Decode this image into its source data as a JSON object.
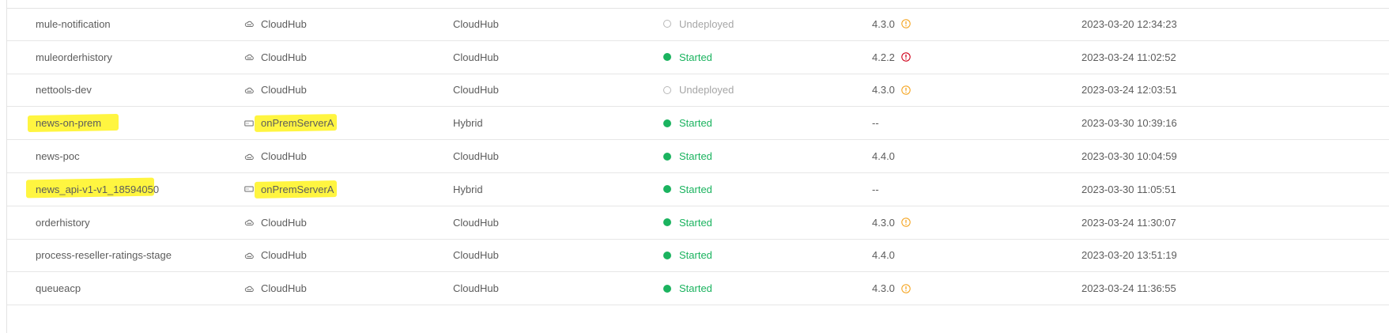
{
  "rows": [
    {
      "name": "mule-notification",
      "target": "CloudHub",
      "target_icon": "cloud-icon",
      "type": "CloudHub",
      "status": "Undeployed",
      "version": "4.3.0",
      "version_flag": "warning",
      "updated": "2023-03-20 12:34:23"
    },
    {
      "name": "muleorderhistory",
      "target": "CloudHub",
      "target_icon": "cloud-icon",
      "type": "CloudHub",
      "status": "Started",
      "version": "4.2.2",
      "version_flag": "error",
      "updated": "2023-03-24 11:02:52"
    },
    {
      "name": "nettools-dev",
      "target": "CloudHub",
      "target_icon": "cloud-icon",
      "type": "CloudHub",
      "status": "Undeployed",
      "version": "4.3.0",
      "version_flag": "warning",
      "updated": "2023-03-24 12:03:51"
    },
    {
      "name": "news-on-prem",
      "target": "onPremServerA",
      "target_icon": "server-icon",
      "type": "Hybrid",
      "status": "Started",
      "version": "--",
      "version_flag": "",
      "updated": "2023-03-30 10:39:16",
      "highlighted": true
    },
    {
      "name": "news-poc",
      "target": "CloudHub",
      "target_icon": "cloud-icon",
      "type": "CloudHub",
      "status": "Started",
      "version": "4.4.0",
      "version_flag": "",
      "updated": "2023-03-30 10:04:59"
    },
    {
      "name": "news_api-v1-v1_18594050",
      "target": "onPremServerA",
      "target_icon": "server-icon",
      "type": "Hybrid",
      "status": "Started",
      "version": "--",
      "version_flag": "",
      "updated": "2023-03-30 11:05:51",
      "highlighted": true
    },
    {
      "name": "orderhistory",
      "target": "CloudHub",
      "target_icon": "cloud-icon",
      "type": "CloudHub",
      "status": "Started",
      "version": "4.3.0",
      "version_flag": "warning",
      "updated": "2023-03-24 11:30:07"
    },
    {
      "name": "process-reseller-ratings-stage",
      "target": "CloudHub",
      "target_icon": "cloud-icon",
      "type": "CloudHub",
      "status": "Started",
      "version": "4.4.0",
      "version_flag": "",
      "updated": "2023-03-20 13:51:19"
    },
    {
      "name": "queueacp",
      "target": "CloudHub",
      "target_icon": "cloud-icon",
      "type": "CloudHub",
      "status": "Started",
      "version": "4.3.0",
      "version_flag": "warning",
      "updated": "2023-03-24 11:36:55"
    }
  ],
  "colors": {
    "started": "#1bb35f",
    "undeployed": "#a6a6a6",
    "warning": "#f5a623",
    "error": "#d0021b",
    "highlight": "#fff200"
  }
}
